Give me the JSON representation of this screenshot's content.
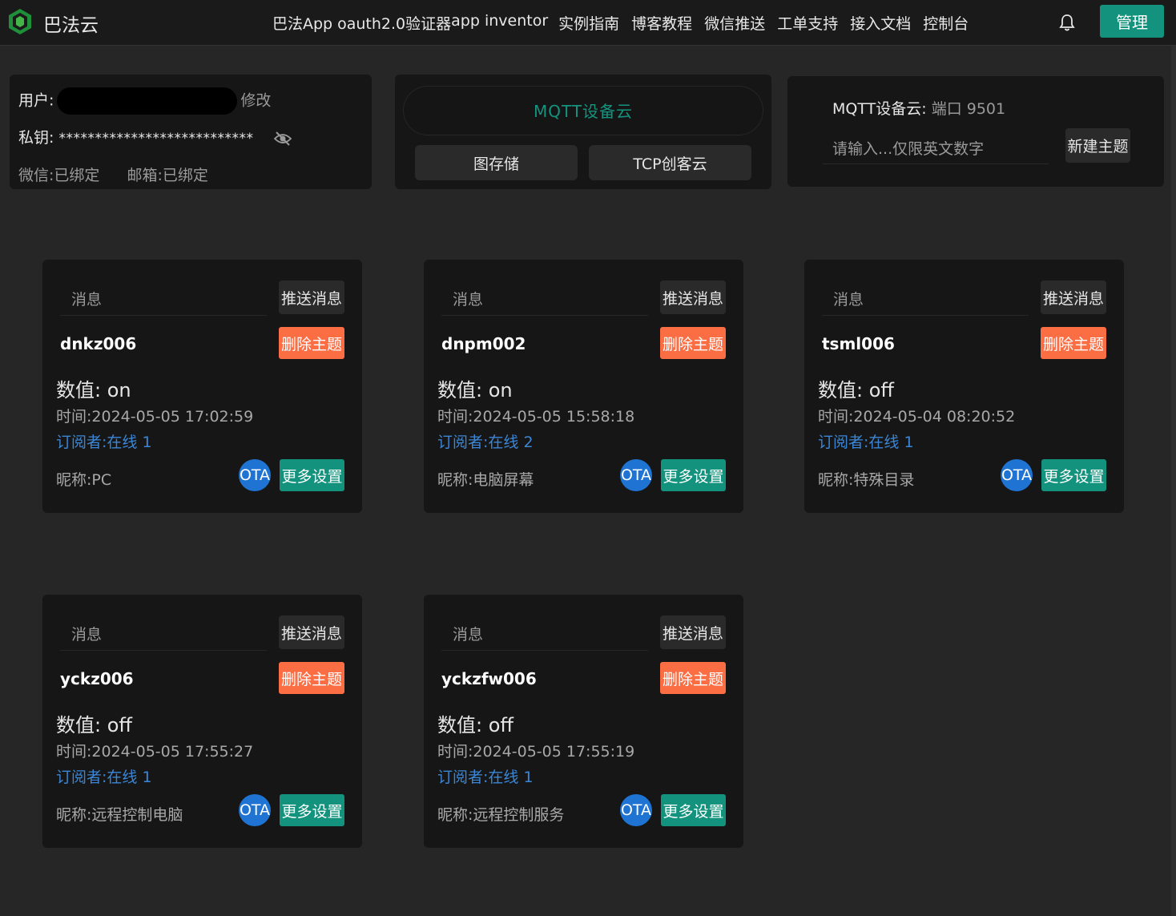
{
  "header": {
    "brand": "巴法云",
    "nav": [
      "巴法App",
      "oauth2.0验证器",
      "app inventor",
      "实例指南",
      "博客教程",
      "微信推送",
      "工单支持",
      "接入文档",
      "控制台"
    ],
    "manage_label": "管理",
    "accent_color": "#13937e"
  },
  "user_panel": {
    "user_label": "用户:",
    "edit_label": "修改",
    "secret_label": "私钥:",
    "secret_value": "***************************",
    "wechat_label": "微信:",
    "wechat_status": "已绑定",
    "email_label": "邮箱:",
    "email_status": "已绑定"
  },
  "cloud_panel": {
    "title": "MQTT设备云",
    "btn_storage": "图存储",
    "btn_tcp": "TCP创客云"
  },
  "new_topic_panel": {
    "label": "MQTT设备云:",
    "port": "端口 9501",
    "placeholder": "请输入...仅限英文数字",
    "button": "新建主题"
  },
  "cards": [
    {
      "msg_placeholder": "消息",
      "push_label": "推送消息",
      "topic": "dnkz006",
      "delete_label": "删除主题",
      "value_label": "数值:",
      "value": "on",
      "time_label": "时间:",
      "time": "2024-05-05 17:02:59",
      "subs_label": "订阅者:",
      "subs": "在线 1",
      "nick_label": "昵称:",
      "nick": "PC",
      "ota_label": "OTA",
      "more_label": "更多设置"
    },
    {
      "msg_placeholder": "消息",
      "push_label": "推送消息",
      "topic": "dnpm002",
      "delete_label": "删除主题",
      "value_label": "数值:",
      "value": "on",
      "time_label": "时间:",
      "time": "2024-05-05 15:58:18",
      "subs_label": "订阅者:",
      "subs": "在线 2",
      "nick_label": "昵称:",
      "nick": "电脑屏幕",
      "ota_label": "OTA",
      "more_label": "更多设置"
    },
    {
      "msg_placeholder": "消息",
      "push_label": "推送消息",
      "topic": "tsml006",
      "delete_label": "删除主题",
      "value_label": "数值:",
      "value": "off",
      "time_label": "时间:",
      "time": "2024-05-04 08:20:52",
      "subs_label": "订阅者:",
      "subs": "在线 1",
      "nick_label": "昵称:",
      "nick": "特殊目录",
      "ota_label": "OTA",
      "more_label": "更多设置"
    },
    {
      "msg_placeholder": "消息",
      "push_label": "推送消息",
      "topic": "yckz006",
      "delete_label": "删除主题",
      "value_label": "数值:",
      "value": "off",
      "time_label": "时间:",
      "time": "2024-05-05 17:55:27",
      "subs_label": "订阅者:",
      "subs": "在线 1",
      "nick_label": "昵称:",
      "nick": "远程控制电脑",
      "ota_label": "OTA",
      "more_label": "更多设置"
    },
    {
      "msg_placeholder": "消息",
      "push_label": "推送消息",
      "topic": "yckzfw006",
      "delete_label": "删除主题",
      "value_label": "数值:",
      "value": "off",
      "time_label": "时间:",
      "time": "2024-05-05 17:55:19",
      "subs_label": "订阅者:",
      "subs": "在线 1",
      "nick_label": "昵称:",
      "nick": "远程控制服务",
      "ota_label": "OTA",
      "more_label": "更多设置"
    }
  ]
}
